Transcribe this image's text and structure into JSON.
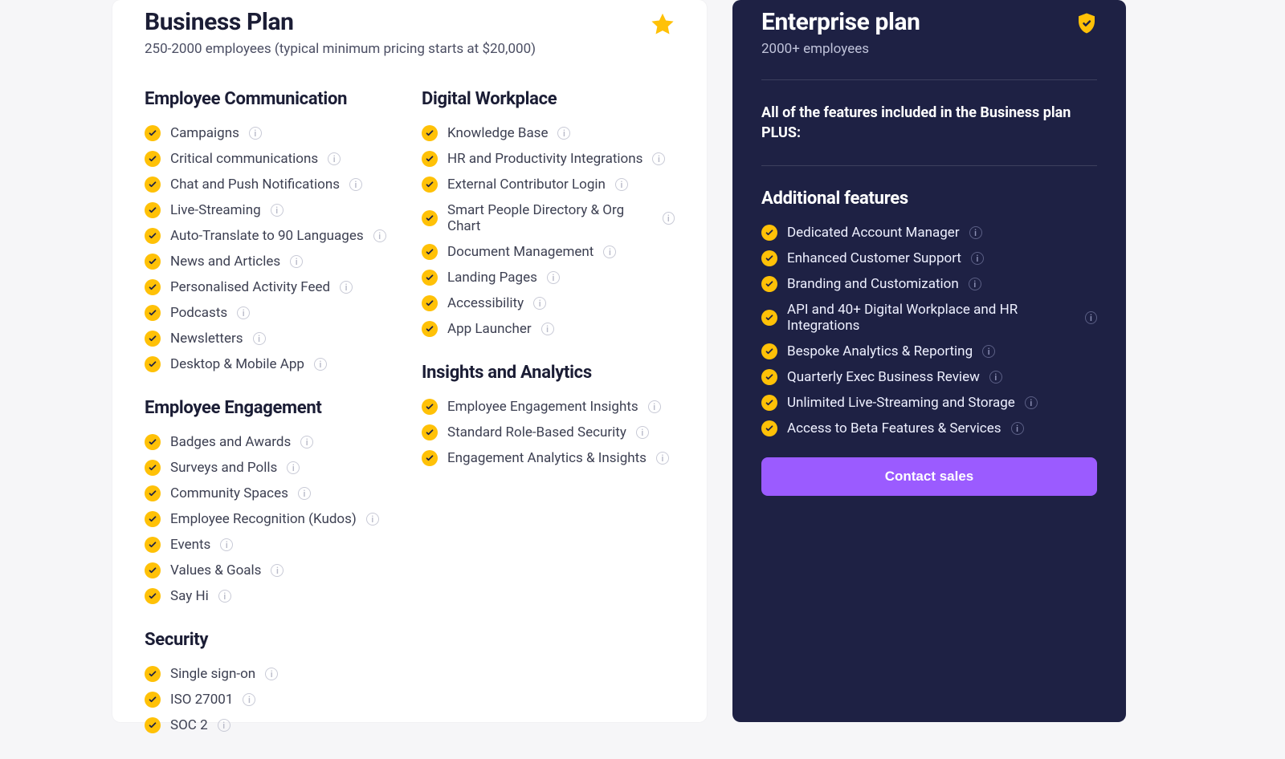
{
  "business": {
    "title": "Business Plan",
    "subtitle": "250-2000 employees (typical minimum pricing starts at $20,000)",
    "columns": {
      "left": [
        {
          "heading": "Employee Communication",
          "items": [
            "Campaigns",
            "Critical communications",
            "Chat and Push Notifications",
            "Live-Streaming",
            "Auto-Translate to 90 Languages",
            "News and Articles",
            "Personalised Activity Feed",
            "Podcasts",
            "Newsletters",
            "Desktop & Mobile App"
          ]
        },
        {
          "heading": "Employee Engagement",
          "items": [
            "Badges and Awards",
            "Surveys and Polls",
            "Community Spaces",
            "Employee Recognition (Kudos)",
            "Events",
            "Values & Goals",
            "Say Hi"
          ]
        },
        {
          "heading": "Security",
          "items": [
            "Single sign-on",
            "ISO 27001",
            "SOC 2"
          ]
        }
      ],
      "right": [
        {
          "heading": "Digital Workplace",
          "items": [
            "Knowledge Base",
            "HR and Productivity Integrations",
            "External Contributor Login",
            "Smart People Directory & Org Chart",
            "Document Management",
            "Landing Pages",
            "Accessibility",
            "App Launcher"
          ]
        },
        {
          "heading": "Insights and Analytics",
          "items": [
            "Employee Engagement Insights",
            "Standard Role-Based Security",
            "Engagement Analytics & Insights"
          ]
        }
      ]
    }
  },
  "enterprise": {
    "title": "Enterprise plan",
    "subtitle": "2000+ employees",
    "plus_line": "All of the features included in the Business plan PLUS:",
    "additional_heading": "Additional features",
    "items": [
      "Dedicated Account Manager",
      "Enhanced Customer Support",
      "Branding and Customization",
      "API and 40+ Digital Workplace and HR Integrations",
      "Bespoke Analytics & Reporting",
      "Quarterly Exec Business Review",
      "Unlimited Live-Streaming and Storage",
      "Access to Beta Features & Services"
    ],
    "cta": "Contact sales"
  }
}
